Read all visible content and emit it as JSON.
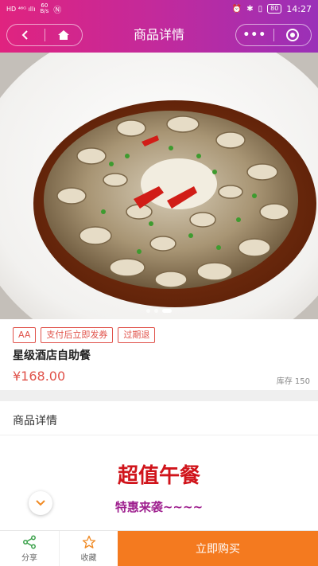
{
  "status_bar": {
    "net_speed_value": "60",
    "net_speed_unit": "B/s",
    "battery": "80",
    "time": "14:27"
  },
  "navbar": {
    "title": "商品详情"
  },
  "product": {
    "tags": [
      "AA",
      "支付后立即发券",
      "过期退"
    ],
    "name": "星级酒店自助餐",
    "price": "¥168.00",
    "stock": "库存 150",
    "image_count": 3,
    "image_active_index": 2
  },
  "detail": {
    "title": "商品详情",
    "promo_main": "超值午餐",
    "promo_sub": "特惠来袭~~~~"
  },
  "bottom_bar": {
    "share_label": "分享",
    "favorite_label": "收藏",
    "buy_label": "立即购买"
  },
  "colors": {
    "nav_gradient_start": "#e0237f",
    "nav_gradient_end": "#9a30b8",
    "price_red": "#e0524a",
    "promo_red": "#d0141b",
    "promo_purple": "#9e1f8e",
    "buy_orange": "#f47a1f"
  },
  "icons": [
    "back-icon",
    "home-icon",
    "more-icon",
    "close-capsule-icon",
    "share-icon",
    "star-icon",
    "chevron-down-icon"
  ]
}
